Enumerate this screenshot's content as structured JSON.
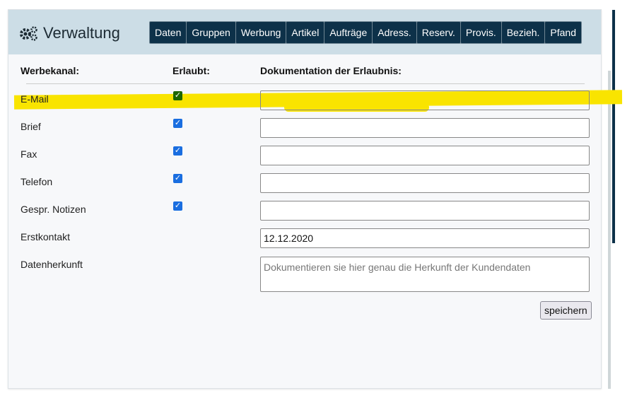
{
  "header": {
    "title": "Verwaltung",
    "tabs": [
      "Daten",
      "Gruppen",
      "Werbung",
      "Artikel",
      "Aufträge",
      "Adress.",
      "Reserv.",
      "Provis.",
      "Bezieh.",
      "Pfand"
    ]
  },
  "columns": {
    "channel": "Werbekanal:",
    "allowed": "Erlaubt:",
    "doc": "Dokumentation der Erlaubnis:"
  },
  "rows": [
    {
      "label": "E-Mail",
      "checked": true,
      "value": ""
    },
    {
      "label": "Brief",
      "checked": true,
      "value": ""
    },
    {
      "label": "Fax",
      "checked": true,
      "value": ""
    },
    {
      "label": "Telefon",
      "checked": true,
      "value": ""
    },
    {
      "label": "Gespr. Notizen",
      "checked": true,
      "value": ""
    }
  ],
  "erstkontakt": {
    "label": "Erstkontakt",
    "value": "12.12.2020"
  },
  "datenherkunft": {
    "label": "Datenherkunft",
    "placeholder": "Dokumentieren sie hier genau die Herkunft der Kundendaten"
  },
  "save_label": "speichern",
  "check": "✓",
  "highlight_color": "#f9e400"
}
